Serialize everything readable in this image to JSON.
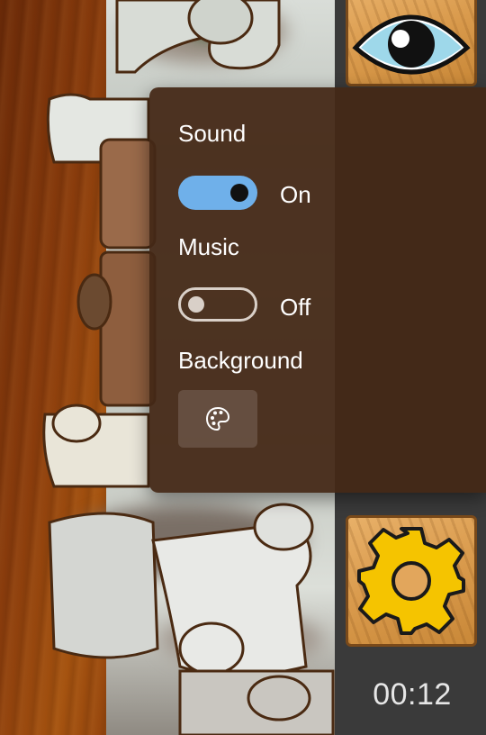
{
  "settings": {
    "sound": {
      "label": "Sound",
      "state": "On",
      "enabled": true
    },
    "music": {
      "label": "Music",
      "state": "Off",
      "enabled": false
    },
    "background": {
      "label": "Background",
      "icon": "palette-icon"
    }
  },
  "toolbar": {
    "preview_icon": "eye-icon",
    "settings_icon": "gear-icon"
  },
  "timer": "00:12",
  "colors": {
    "accent": "#6fb0ea",
    "panel": "#44281a",
    "gear": "#f5c400"
  }
}
